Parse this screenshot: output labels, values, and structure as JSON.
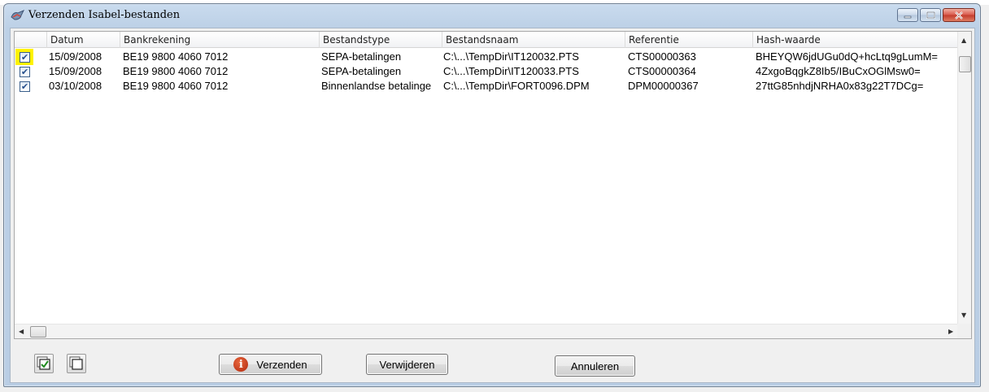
{
  "window": {
    "title": "Verzenden Isabel-bestanden",
    "icon": "isabel-app-icon",
    "caption_buttons": [
      "minimize-icon",
      "maximize-icon",
      "close-icon"
    ]
  },
  "table": {
    "columns": [
      "Datum",
      "Bankrekening",
      "Bestandstype",
      "Bestandsnaam",
      "Referentie",
      "Hash-waarde"
    ],
    "rows": [
      {
        "checked": true,
        "selected": true,
        "datum": "15/09/2008",
        "bankrekening": "BE19 9800 4060 7012",
        "bestandstype": "SEPA-betalingen",
        "bestandsnaam": "C:\\...\\TempDir\\IT120032.PTS",
        "referentie": "CTS00000363",
        "hash": "BHEYQW6jdUGu0dQ+hcLtq9gLumM="
      },
      {
        "checked": true,
        "selected": false,
        "datum": "15/09/2008",
        "bankrekening": "BE19 9800 4060 7012",
        "bestandstype": "SEPA-betalingen",
        "bestandsnaam": "C:\\...\\TempDir\\IT120033.PTS",
        "referentie": "CTS00000364",
        "hash": "4ZxgoBqgkZ8Ib5/IBuCxOGlMsw0="
      },
      {
        "checked": true,
        "selected": false,
        "datum": "03/10/2008",
        "bankrekening": "BE19 9800 4060 7012",
        "bestandstype": "Binnenlandse betalinge",
        "bestandsnaam": "C:\\...\\TempDir\\FORT0096.DPM",
        "referentie": "DPM00000367",
        "hash": "27ttG85nhdjNRHA0x83g22T7DCg="
      }
    ]
  },
  "toolbar": {
    "select_all_icon": "check-all-icon",
    "deselect_all_icon": "uncheck-all-icon",
    "send_label": "Verzenden",
    "delete_label": "Verwijderen",
    "cancel_label": "Annuleren"
  }
}
